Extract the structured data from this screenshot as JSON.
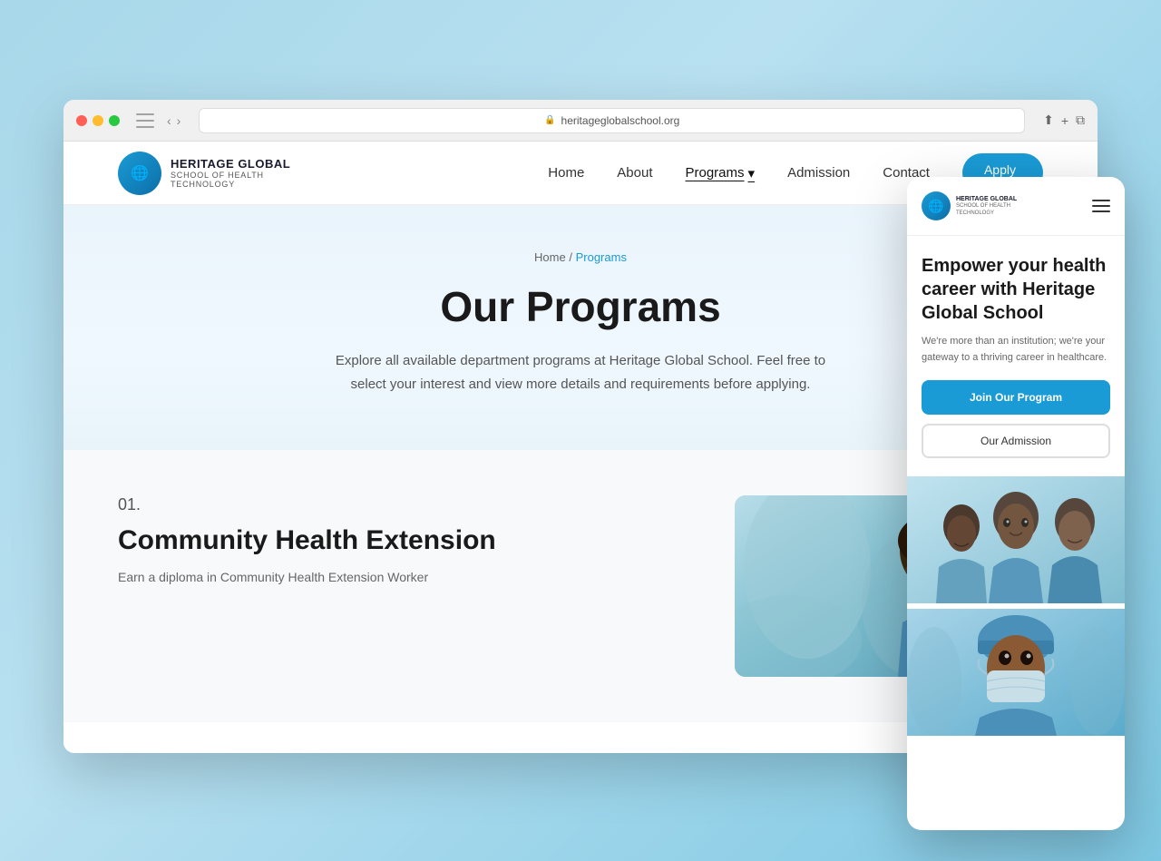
{
  "browser": {
    "url": "heritageglobalschool.org",
    "back_arrow": "‹",
    "forward_arrow": "›"
  },
  "site": {
    "logo": {
      "icon": "🌐",
      "title": "HERITAGE GLOBAL",
      "subtitle_line1": "SCHOOL OF HEALTH",
      "subtitle_line2": "TECHNOLOGY"
    },
    "nav": {
      "home": "Home",
      "about": "About",
      "programs": "Programs",
      "admission": "Admission",
      "contact": "Contact",
      "apply_btn": "Apply",
      "apply_dots": [
        "",
        "",
        ""
      ]
    },
    "breadcrumb": {
      "home": "Home",
      "separator": " / ",
      "current": "Programs"
    },
    "hero": {
      "title": "Our Programs",
      "subtitle": "Explore all available department programs at Heritage Global School. Feel free to select your interest and view more details and requirements before applying."
    },
    "programs": [
      {
        "number": "01.",
        "name": "Community Health Extension",
        "description": "Earn a diploma in Community Health Extension Worker"
      }
    ]
  },
  "mobile": {
    "logo": {
      "icon": "🌐",
      "title": "HERITAGE GLOBAL",
      "subtitle": "SCHOOL OF HEALTH\nTECHNOLOGY"
    },
    "hero": {
      "title": "Empower your health career with Heritage Global School",
      "subtitle": "We're more than an institution; we're your gateway to a thriving career in healthcare."
    },
    "btn_primary": "Join Our Program",
    "btn_secondary": "Our Admission"
  }
}
